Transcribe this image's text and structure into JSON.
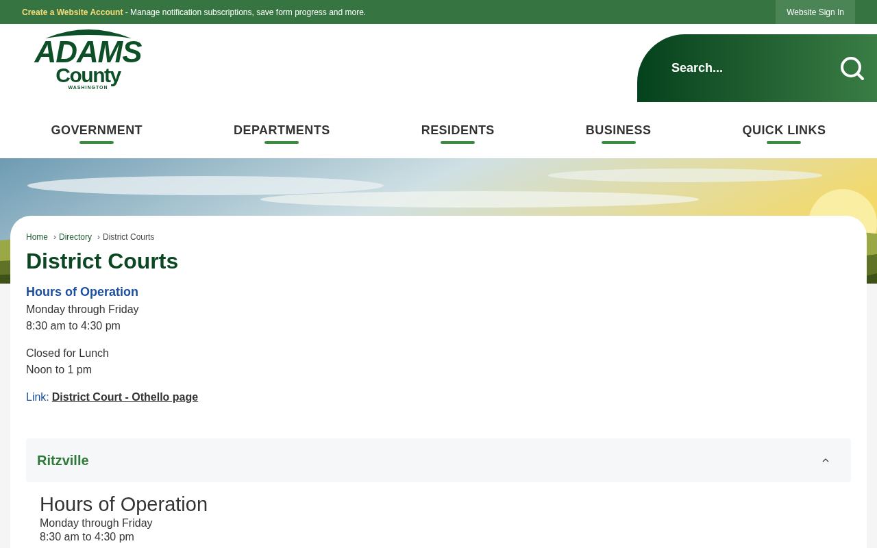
{
  "top_bar": {
    "account_link": "Create a Website Account",
    "message": " - Manage notification subscriptions, save form progress and more.",
    "sign_in": "Website Sign In"
  },
  "logo": {
    "line_1": "ADAMS",
    "line_2": "County",
    "line_3": "WASHINGTON"
  },
  "search": {
    "placeholder": "Search..."
  },
  "breadcrumb_separator": "›",
  "nav": [
    {
      "label": "GOVERNMENT"
    },
    {
      "label": "DEPARTMENTS"
    },
    {
      "label": "RESIDENTS"
    },
    {
      "label": "BUSINESS"
    },
    {
      "label": "QUICK LINKS"
    }
  ],
  "breadcrumb": [
    "Home",
    "Directory",
    "District Courts"
  ],
  "title": "District Courts",
  "hours_heading": "Hours of Operation",
  "hours_lines": [
    "Monday through Friday",
    "8:30 am to 4:30 pm"
  ],
  "lunch_lines": [
    "Closed for Lunch",
    "Noon to 1 pm"
  ],
  "link_label": "Link:",
  "link_text": "District Court - Othello page",
  "accordion": {
    "title": "Ritzville",
    "expanded": true,
    "heading": "Hours of Operation",
    "lines": [
      "Monday through Friday",
      "8:30 am to 4:30 pm"
    ]
  }
}
